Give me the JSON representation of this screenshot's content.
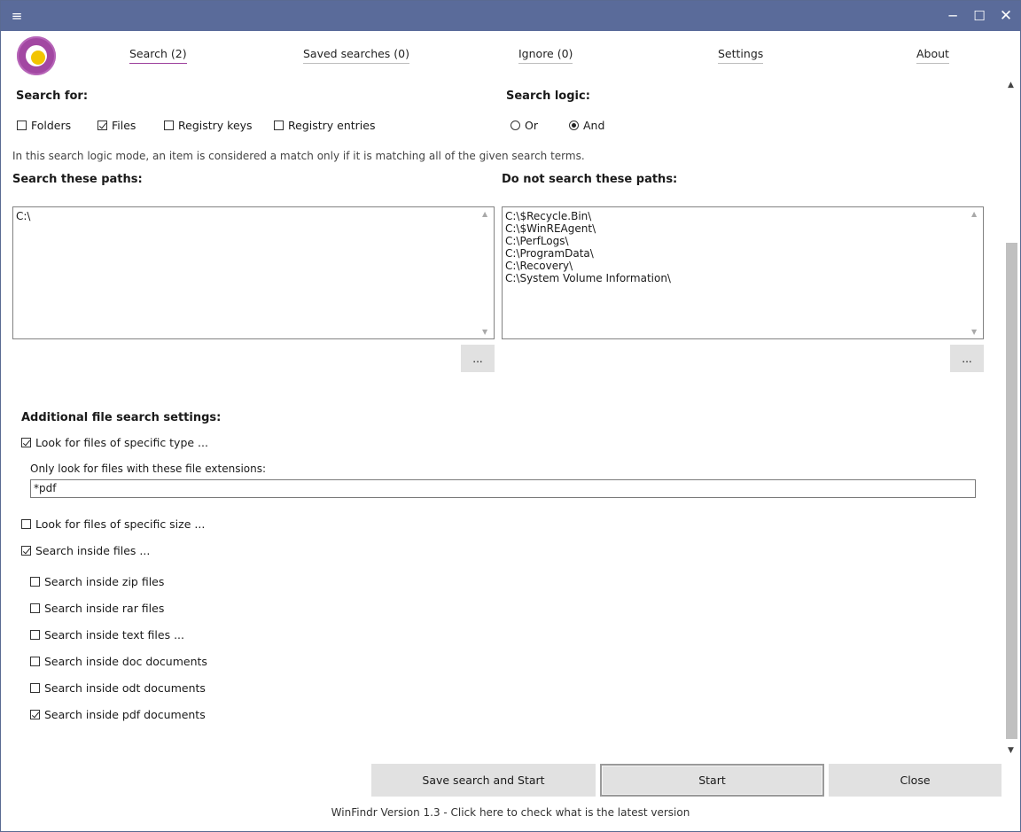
{
  "titlebar": {
    "menu_icon": "≡",
    "minimize_icon": "─",
    "maximize_icon": "☐",
    "close_icon": "✕"
  },
  "nav": {
    "search": "Search (2)",
    "saved": "Saved searches (0)",
    "ignore": "Ignore (0)",
    "settings": "Settings",
    "about": "About"
  },
  "search_for": {
    "heading": "Search for:",
    "folders": "Folders",
    "files": "Files",
    "registry_keys": "Registry keys",
    "registry_entries": "Registry entries",
    "folders_checked": false,
    "files_checked": true,
    "registry_keys_checked": false,
    "registry_entries_checked": false
  },
  "search_logic": {
    "heading": "Search logic:",
    "or": "Or",
    "and": "And",
    "selected": "And",
    "description": "In this search logic mode, an item is considered a match only if it is matching all of the given search terms."
  },
  "paths": {
    "include_heading": "Search these paths:",
    "exclude_heading": "Do not search these paths:",
    "include": [
      "C:\\"
    ],
    "exclude": [
      "C:\\$Recycle.Bin\\",
      "C:\\$WinREAgent\\",
      "C:\\PerfLogs\\",
      "C:\\ProgramData\\",
      "C:\\Recovery\\",
      "C:\\System Volume Information\\"
    ],
    "browse_label": "..."
  },
  "additional": {
    "heading": "Additional file search settings:",
    "specific_type": "Look for files of specific type ...",
    "extensions_label": "Only look for files with these file extensions:",
    "extensions_value": "*pdf",
    "specific_size": "Look for files of specific size ...",
    "search_inside": "Search inside files ...",
    "inside_zip": "Search inside zip files",
    "inside_rar": "Search inside rar files",
    "inside_text": "Search inside text files ...",
    "inside_doc": "Search inside doc documents",
    "inside_odt": "Search inside odt documents",
    "inside_pdf": "Search inside pdf documents"
  },
  "buttons": {
    "save_start": "Save search and Start",
    "start": "Start",
    "close": "Close"
  },
  "footer": "WinFindr Version 1.3 - Click here to check what is the latest version"
}
